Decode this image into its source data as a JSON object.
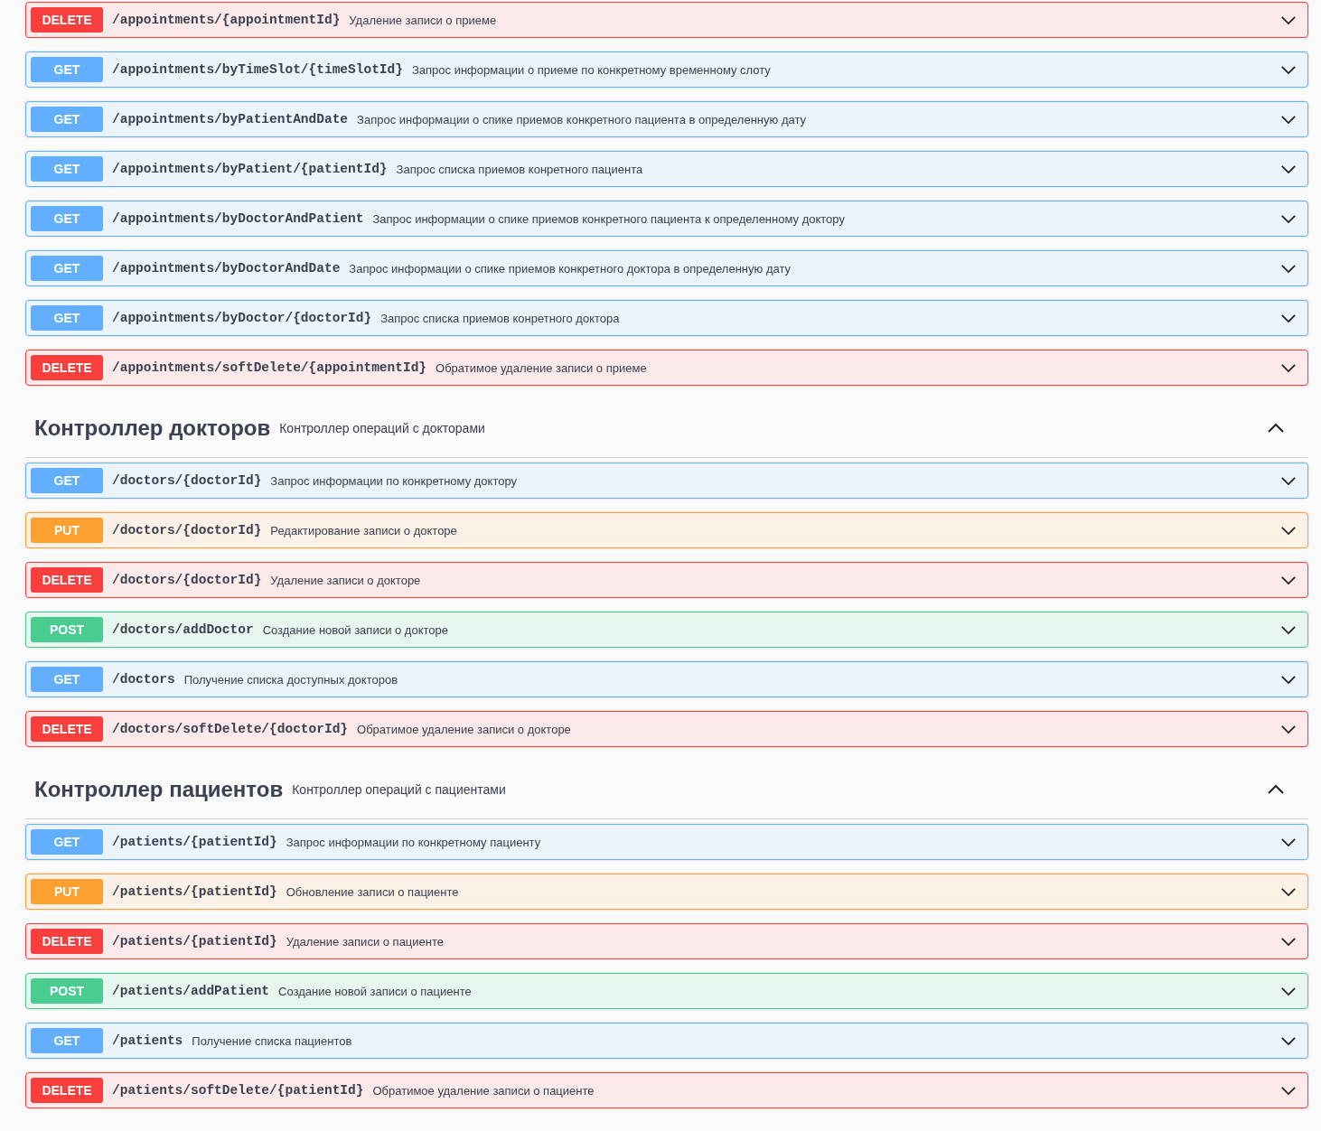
{
  "groups": [
    {
      "operations": [
        {
          "method": "DELETE",
          "path": "/appointments/{appointmentId}",
          "summary": "Удаление записи о приеме",
          "expanded": false
        },
        {
          "method": "GET",
          "path": "/appointments/byTimeSlot/{timeSlotId}",
          "summary": "Запрос информации о приеме по конкретному временному слоту",
          "expanded": false
        },
        {
          "method": "GET",
          "path": "/appointments/byPatientAndDate",
          "summary": "Запрос информации о спике приемов конкретного пациента в определенную дату",
          "expanded": false
        },
        {
          "method": "GET",
          "path": "/appointments/byPatient/{patientId}",
          "summary": "Запрос списка приемов конретного пациента",
          "expanded": false
        },
        {
          "method": "GET",
          "path": "/appointments/byDoctorAndPatient",
          "summary": "Запрос информации о спике приемов конкретного пациента к определенному доктору",
          "expanded": false
        },
        {
          "method": "GET",
          "path": "/appointments/byDoctorAndDate",
          "summary": "Запрос информации о спике приемов конкретного доктора в определенную дату",
          "expanded": false
        },
        {
          "method": "GET",
          "path": "/appointments/byDoctor/{doctorId}",
          "summary": "Запрос списка приемов конретного доктора",
          "expanded": false
        },
        {
          "method": "DELETE",
          "path": "/appointments/softDelete/{appointmentId}",
          "summary": "Обратимое удаление записи о приеме",
          "expanded": false
        }
      ]
    },
    {
      "title": "Контроллер докторов",
      "description": "Контроллер операций с докторами",
      "expanded": true,
      "operations": [
        {
          "method": "GET",
          "path": "/doctors/{doctorId}",
          "summary": "Запрос информации по конкретному доктору",
          "expanded": false
        },
        {
          "method": "PUT",
          "path": "/doctors/{doctorId}",
          "summary": "Редактирование записи о докторе",
          "expanded": false
        },
        {
          "method": "DELETE",
          "path": "/doctors/{doctorId}",
          "summary": "Удаление записи о докторе",
          "expanded": false
        },
        {
          "method": "POST",
          "path": "/doctors/addDoctor",
          "summary": "Создание новой записи о докторе",
          "expanded": false
        },
        {
          "method": "GET",
          "path": "/doctors",
          "summary": "Получение списка доступных докторов",
          "expanded": false
        },
        {
          "method": "DELETE",
          "path": "/doctors/softDelete/{doctorId}",
          "summary": "Обратимое удаление записи о докторе",
          "expanded": false
        }
      ]
    },
    {
      "title": "Контроллер пациентов",
      "description": "Контроллер операций с пациентами",
      "expanded": true,
      "operations": [
        {
          "method": "GET",
          "path": "/patients/{patientId}",
          "summary": "Запрос информации по конкретному пациенту",
          "expanded": false
        },
        {
          "method": "PUT",
          "path": "/patients/{patientId}",
          "summary": "Обновление записи о пациенте",
          "expanded": false
        },
        {
          "method": "DELETE",
          "path": "/patients/{patientId}",
          "summary": "Удаление записи о пациенте",
          "expanded": false
        },
        {
          "method": "POST",
          "path": "/patients/addPatient",
          "summary": "Создание новой записи о пациенте",
          "expanded": false
        },
        {
          "method": "GET",
          "path": "/patients",
          "summary": "Получение списка пациентов",
          "expanded": false
        },
        {
          "method": "DELETE",
          "path": "/patients/softDelete/{patientId}",
          "summary": "Обратимое удаление записи о пациенте",
          "expanded": false
        }
      ]
    }
  ]
}
